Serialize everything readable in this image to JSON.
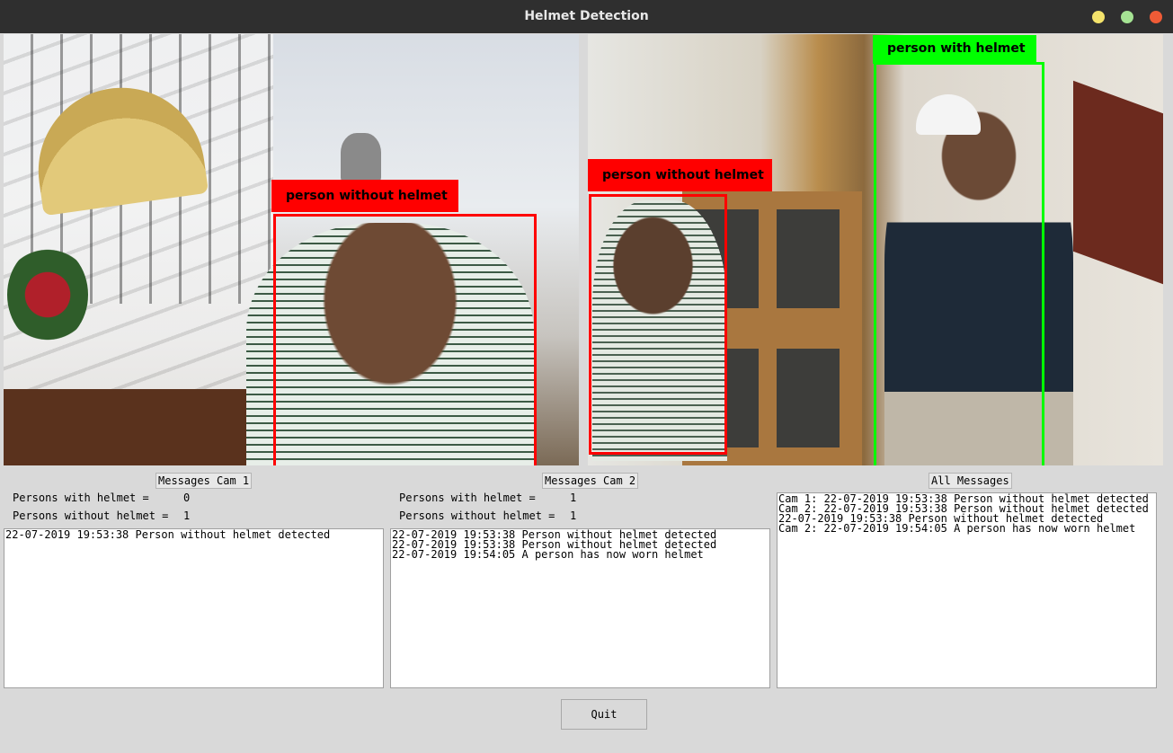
{
  "window": {
    "title": "Helmet Detection",
    "buttons": {
      "minimize": "minimize-icon",
      "maximize": "maximize-icon",
      "close": "close-icon"
    },
    "colors": {
      "minimize": "#f4e36b",
      "maximize": "#a5e393",
      "close": "#ef5b36"
    }
  },
  "cam1": {
    "detections": [
      {
        "label": "person without helmet",
        "color": "#ff0000"
      }
    ]
  },
  "cam2": {
    "detections": [
      {
        "label": "person without helmet",
        "color": "#ff0000"
      },
      {
        "label": "person with helmet",
        "color": "#00ff00"
      }
    ]
  },
  "panels": {
    "cam1": {
      "header": "Messages Cam 1",
      "with_label": "Persons with helmet =",
      "with_value": "0",
      "without_label": "Persons without helmet =",
      "without_value": "1",
      "messages": [
        "22-07-2019 19:53:38 Person without helmet detected"
      ]
    },
    "cam2": {
      "header": "Messages Cam 2",
      "with_label": "Persons with helmet =",
      "with_value": "1",
      "without_label": "Persons without helmet =",
      "without_value": "1",
      "messages": [
        "22-07-2019 19:53:38 Person without helmet detected",
        "22-07-2019 19:53:38 Person without helmet detected",
        "22-07-2019 19:54:05 A person has now worn helmet"
      ]
    },
    "all": {
      "header": "All Messages",
      "messages": [
        "Cam 1: 22-07-2019 19:53:38 Person without helmet detected",
        "Cam 2: 22-07-2019 19:53:38 Person without helmet detected",
        "22-07-2019 19:53:38 Person without helmet detected",
        "Cam 2: 22-07-2019 19:54:05 A person has now worn helmet"
      ]
    }
  },
  "quit_label": "Quit"
}
